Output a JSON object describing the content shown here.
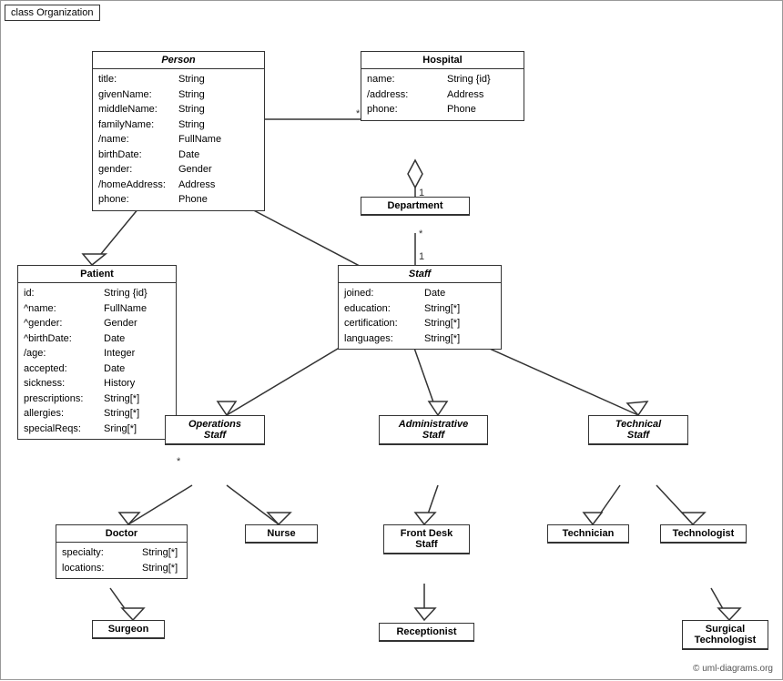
{
  "diagram": {
    "title": "class Organization",
    "copyright": "© uml-diagrams.org",
    "classes": {
      "person": {
        "name": "Person",
        "italic": true,
        "attrs": [
          {
            "name": "title:",
            "type": "String"
          },
          {
            "name": "givenName:",
            "type": "String"
          },
          {
            "name": "middleName:",
            "type": "String"
          },
          {
            "name": "familyName:",
            "type": "String"
          },
          {
            "name": "/name:",
            "type": "FullName"
          },
          {
            "name": "birthDate:",
            "type": "Date"
          },
          {
            "name": "gender:",
            "type": "Gender"
          },
          {
            "name": "/homeAddress:",
            "type": "Address"
          },
          {
            "name": "phone:",
            "type": "Phone"
          }
        ]
      },
      "hospital": {
        "name": "Hospital",
        "italic": false,
        "attrs": [
          {
            "name": "name:",
            "type": "String {id}"
          },
          {
            "name": "/address:",
            "type": "Address"
          },
          {
            "name": "phone:",
            "type": "Phone"
          }
        ]
      },
      "patient": {
        "name": "Patient",
        "italic": false,
        "attrs": [
          {
            "name": "id:",
            "type": "String {id}"
          },
          {
            "name": "^name:",
            "type": "FullName"
          },
          {
            "name": "^gender:",
            "type": "Gender"
          },
          {
            "name": "^birthDate:",
            "type": "Date"
          },
          {
            "name": "/age:",
            "type": "Integer"
          },
          {
            "name": "accepted:",
            "type": "Date"
          },
          {
            "name": "sickness:",
            "type": "History"
          },
          {
            "name": "prescriptions:",
            "type": "String[*]"
          },
          {
            "name": "allergies:",
            "type": "String[*]"
          },
          {
            "name": "specialReqs:",
            "type": "Sring[*]"
          }
        ]
      },
      "department": {
        "name": "Department",
        "italic": false,
        "attrs": []
      },
      "staff": {
        "name": "Staff",
        "italic": true,
        "attrs": [
          {
            "name": "joined:",
            "type": "Date"
          },
          {
            "name": "education:",
            "type": "String[*]"
          },
          {
            "name": "certification:",
            "type": "String[*]"
          },
          {
            "name": "languages:",
            "type": "String[*]"
          }
        ]
      },
      "operations_staff": {
        "name": "Operations\nStaff",
        "italic": true
      },
      "administrative_staff": {
        "name": "Administrative\nStaff",
        "italic": true
      },
      "technical_staff": {
        "name": "Technical\nStaff",
        "italic": true
      },
      "doctor": {
        "name": "Doctor",
        "italic": false,
        "attrs": [
          {
            "name": "specialty:",
            "type": "String[*]"
          },
          {
            "name": "locations:",
            "type": "String[*]"
          }
        ]
      },
      "nurse": {
        "name": "Nurse",
        "italic": false
      },
      "front_desk_staff": {
        "name": "Front Desk\nStaff",
        "italic": false
      },
      "technician": {
        "name": "Technician",
        "italic": false
      },
      "technologist": {
        "name": "Technologist",
        "italic": false
      },
      "surgeon": {
        "name": "Surgeon",
        "italic": false
      },
      "receptionist": {
        "name": "Receptionist",
        "italic": false
      },
      "surgical_technologist": {
        "name": "Surgical\nTechnologist",
        "italic": false
      }
    }
  }
}
